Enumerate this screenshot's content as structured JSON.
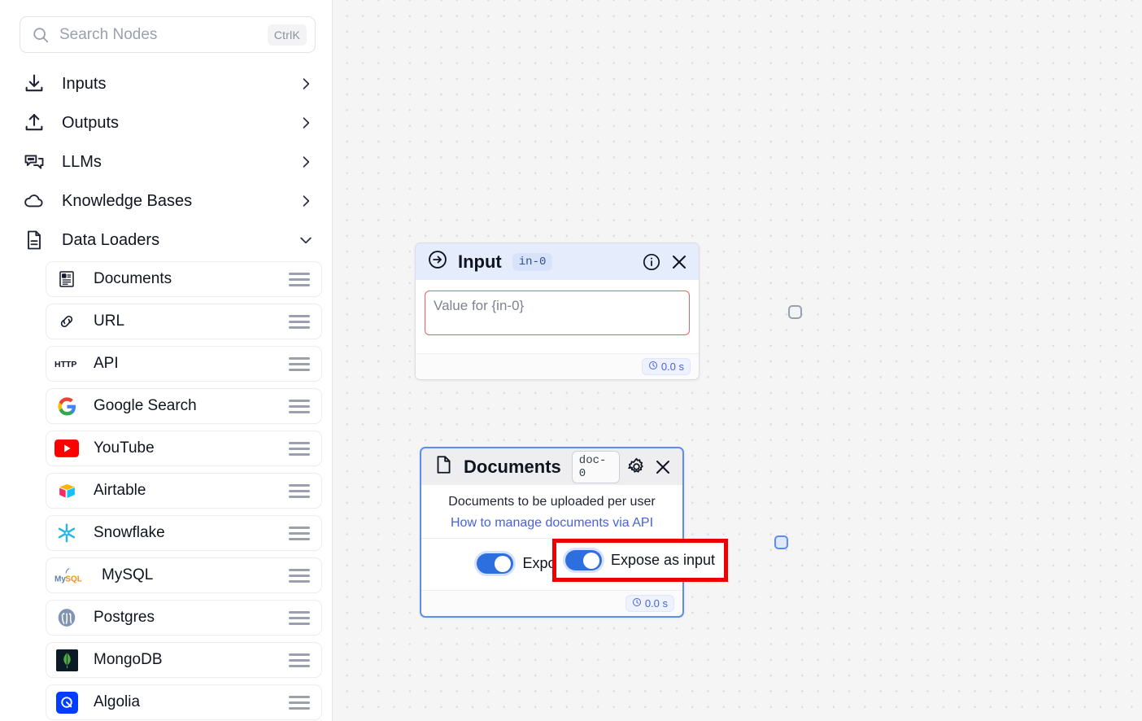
{
  "sidebar": {
    "search": {
      "placeholder": "Search Nodes",
      "value": "",
      "shortcut": "CtrlK",
      "icon": "search-icon"
    },
    "categories": [
      {
        "label": "Inputs",
        "icon": "download-icon",
        "expanded": false,
        "chevron": "chevron-right-icon"
      },
      {
        "label": "Outputs",
        "icon": "upload-icon",
        "expanded": false,
        "chevron": "chevron-right-icon"
      },
      {
        "label": "LLMs",
        "icon": "chat-bubbles-icon",
        "expanded": false,
        "chevron": "chevron-right-icon"
      },
      {
        "label": "Knowledge Bases",
        "icon": "cloud-icon",
        "expanded": false,
        "chevron": "chevron-right-icon"
      },
      {
        "label": "Data Loaders",
        "icon": "document-icon",
        "expanded": true,
        "chevron": "chevron-down-icon"
      }
    ],
    "nodes": [
      {
        "label": "Documents",
        "icon": "documents-icon"
      },
      {
        "label": "URL",
        "icon": "link-icon"
      },
      {
        "label": "API",
        "icon": "http-icon"
      },
      {
        "label": "Google Search",
        "icon": "google-icon"
      },
      {
        "label": "YouTube",
        "icon": "youtube-icon"
      },
      {
        "label": "Airtable",
        "icon": "airtable-icon"
      },
      {
        "label": "Snowflake",
        "icon": "snowflake-icon"
      },
      {
        "label": "MySQL",
        "icon": "mysql-icon"
      },
      {
        "label": "Postgres",
        "icon": "postgres-icon"
      },
      {
        "label": "MongoDB",
        "icon": "mongodb-icon"
      },
      {
        "label": "Algolia",
        "icon": "algolia-icon"
      }
    ],
    "drag_handle_icon": "drag-handle-icon"
  },
  "canvas": {
    "input_node": {
      "title": "Input",
      "badge": "in-0",
      "icon": "arrow-in-circle-icon",
      "info_icon": "info-icon",
      "close_icon": "close-icon",
      "textarea_placeholder": "Value for {in-0}",
      "textarea_value": "",
      "runtime": "0.0 s",
      "clock_icon": "clock-icon",
      "handle_icon": "output-handle"
    },
    "documents_node": {
      "title": "Documents",
      "badge": "doc-0",
      "icon": "page-icon",
      "settings_icon": "gear-icon",
      "close_icon": "close-icon",
      "description": "Documents to be uploaded per user",
      "link_text": "How to manage documents via API",
      "toggle_label": "Expose as input",
      "toggle_on": true,
      "runtime": "0.0 s",
      "clock_icon": "clock-icon",
      "handle_icon": "output-handle"
    }
  },
  "colors": {
    "accent_blue": "#4763d6",
    "toggle_on": "#2e6fe0",
    "node_selected_border": "#5b8def",
    "highlight_red": "#ee0000",
    "textarea_border_red": "#e06464",
    "input_header_bg": "#e5ecfb",
    "doc_header_bg": "#eeeef0",
    "canvas_bg": "#f5f5f6"
  }
}
